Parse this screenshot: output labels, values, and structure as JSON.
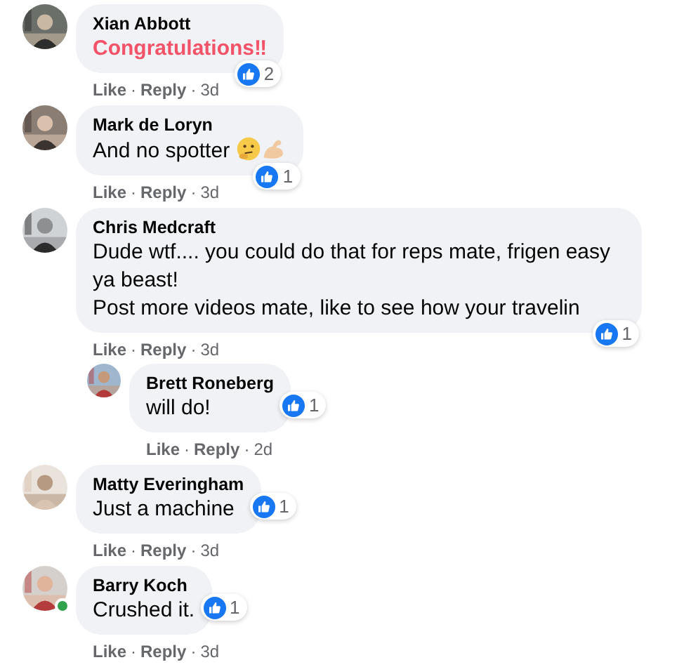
{
  "comments": [
    {
      "author": "Xian Abbott",
      "lines": [
        {
          "text": "Congratulations‼",
          "kind": "highlight"
        }
      ],
      "reactions": "2",
      "footer": [
        {
          "kind": "link",
          "text": "Like"
        },
        {
          "kind": "separator",
          "text": "·"
        },
        {
          "kind": "link",
          "text": "Reply"
        },
        {
          "kind": "separator",
          "text": "·"
        },
        {
          "kind": "time",
          "text": "3d"
        }
      ]
    },
    {
      "author": "Mark de Loryn",
      "lines": [
        {
          "text": "And no spotter",
          "kind": "plain",
          "trailing_icons": [
            {
              "kind": "thinking"
            },
            {
              "kind": "muscle"
            }
          ]
        }
      ],
      "reactions": "1",
      "footer": [
        {
          "kind": "link",
          "text": "Like"
        },
        {
          "kind": "separator",
          "text": "·"
        },
        {
          "kind": "link",
          "text": "Reply"
        },
        {
          "kind": "separator",
          "text": "·"
        },
        {
          "kind": "time",
          "text": "3d"
        }
      ]
    },
    {
      "author": "Chris Medcraft",
      "lines": [
        {
          "text": "Dude wtf.... you could do that for reps mate, frigen easy ya beast!",
          "kind": "plain"
        },
        {
          "text": "Post more videos mate, like to see how your travelin",
          "kind": "plain"
        }
      ],
      "reactions": "1",
      "footer": [
        {
          "kind": "link",
          "text": "Like"
        },
        {
          "kind": "separator",
          "text": "·"
        },
        {
          "kind": "link",
          "text": "Reply"
        },
        {
          "kind": "separator",
          "text": "·"
        },
        {
          "kind": "time",
          "text": "3d"
        }
      ],
      "children": [
        {
          "author": "Brett Roneberg",
          "lines": [
            {
              "text": "will do!",
              "kind": "plain"
            }
          ],
          "reactions": "1",
          "footer": [
            {
              "kind": "link",
              "text": "Like"
            },
            {
              "kind": "separator",
              "text": "·"
            },
            {
              "kind": "link",
              "text": "Reply"
            },
            {
              "kind": "separator",
              "text": "·"
            },
            {
              "kind": "time",
              "text": "2d"
            }
          ]
        }
      ]
    },
    {
      "author": "Matty Everingham",
      "lines": [
        {
          "text": "Just a machine",
          "kind": "plain"
        }
      ],
      "reactions": "1",
      "footer": [
        {
          "kind": "link",
          "text": "Like"
        },
        {
          "kind": "separator",
          "text": "·"
        },
        {
          "kind": "link",
          "text": "Reply"
        },
        {
          "kind": "separator",
          "text": "·"
        },
        {
          "kind": "time",
          "text": "3d"
        }
      ]
    },
    {
      "author": "Barry Koch",
      "online": true,
      "lines": [
        {
          "text": "Crushed it.",
          "kind": "plain"
        }
      ],
      "reactions": "1",
      "footer": [
        {
          "kind": "link",
          "text": "Like"
        },
        {
          "kind": "separator",
          "text": "·"
        },
        {
          "kind": "link",
          "text": "Reply"
        },
        {
          "kind": "separator",
          "text": "·"
        },
        {
          "kind": "time",
          "text": "3d"
        }
      ]
    }
  ]
}
